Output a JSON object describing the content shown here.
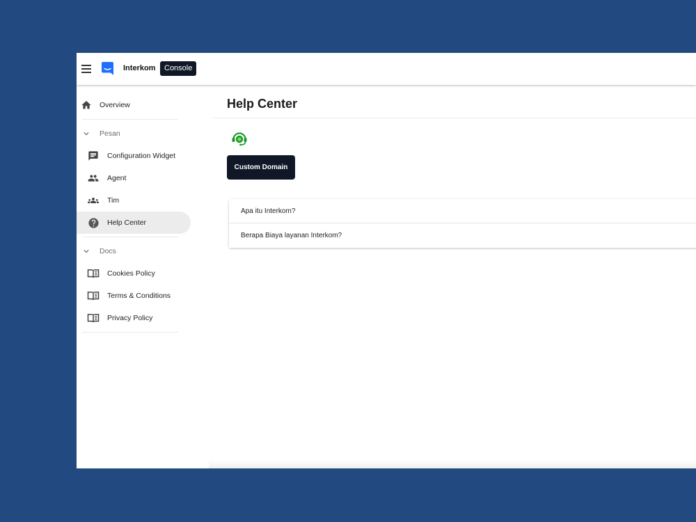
{
  "header": {
    "brand": "Interkom",
    "badge": "Console"
  },
  "sidebar": {
    "overview": "Overview",
    "sections": [
      {
        "title": "Pesan",
        "items": [
          {
            "label": "Configuration Widget",
            "icon": "chat-icon"
          },
          {
            "label": "Agent",
            "icon": "people-icon"
          },
          {
            "label": "Tim",
            "icon": "groups-icon"
          },
          {
            "label": "Help Center",
            "icon": "help-icon",
            "active": true
          }
        ]
      },
      {
        "title": "Docs",
        "items": [
          {
            "label": "Cookies Policy",
            "icon": "book-icon"
          },
          {
            "label": "Terms & Conditions",
            "icon": "book-icon"
          },
          {
            "label": "Privacy Policy",
            "icon": "book-icon"
          }
        ]
      }
    ]
  },
  "main": {
    "title": "Help Center",
    "button": "Custom Domain",
    "faqs": [
      "Apa itu Interkom?",
      "Berapa Biaya layanan Interkom?"
    ]
  },
  "colors": {
    "background": "#224a80",
    "primary_dark": "#101828",
    "brand_blue": "#1f6fff",
    "support_green": "#1a9a2a"
  }
}
